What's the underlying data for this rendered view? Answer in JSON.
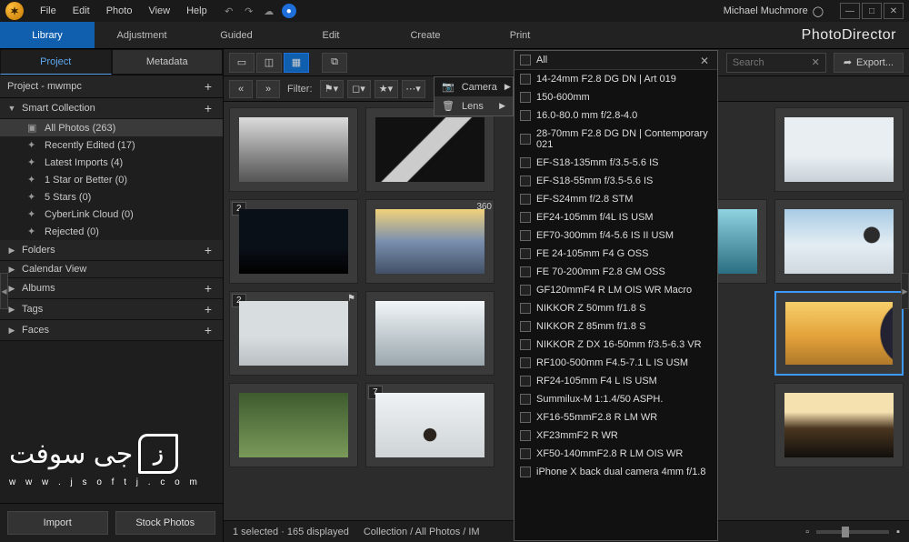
{
  "menu": {
    "file": "File",
    "edit": "Edit",
    "photo": "Photo",
    "view": "View",
    "help": "Help"
  },
  "user": {
    "name": "Michael Muchmore"
  },
  "brand": "PhotoDirector",
  "modules": {
    "library": "Library",
    "adjustment": "Adjustment",
    "guided": "Guided",
    "edit": "Edit",
    "create": "Create",
    "print": "Print"
  },
  "side_tabs": {
    "project": "Project",
    "metadata": "Metadata"
  },
  "project_header": "Project - mwmpc",
  "smart_collection": "Smart Collection",
  "tree_items": {
    "all_photos": "All Photos (263)",
    "recently_edited": "Recently Edited (17)",
    "latest_imports": "Latest Imports (4)",
    "one_star": "1 Star or Better (0)",
    "five_stars": "5 Stars (0)",
    "cloud": "CyberLink Cloud (0)",
    "rejected": "Rejected (0)"
  },
  "sections": {
    "folders": "Folders",
    "calendar": "Calendar View",
    "albums": "Albums",
    "tags": "Tags",
    "faces": "Faces"
  },
  "side_buttons": {
    "import": "Import",
    "stock": "Stock Photos"
  },
  "toolbar": {
    "filter_label": "Filter:",
    "search_placeholder": "Search",
    "export": "Export..."
  },
  "submenu": {
    "camera": "Camera",
    "lens": "Lens"
  },
  "lens_filter": {
    "all": "All",
    "items": [
      "14-24mm F2.8 DG DN | Art 019",
      "150-600mm",
      "16.0-80.0 mm f/2.8-4.0",
      "28-70mm F2.8 DG DN | Contemporary 021",
      "EF-S18-135mm f/3.5-5.6 IS",
      "EF-S18-55mm f/3.5-5.6 IS",
      "EF-S24mm f/2.8 STM",
      "EF24-105mm f/4L IS USM",
      "EF70-300mm f/4-5.6 IS II USM",
      "FE 24-105mm F4 G OSS",
      "FE 70-200mm F2.8 GM OSS",
      "GF120mmF4 R LM OIS WR Macro",
      "NIKKOR Z 50mm f/1.8 S",
      "NIKKOR Z 85mm f/1.8 S",
      "NIKKOR Z DX 16-50mm f/3.5-6.3 VR",
      "RF100-500mm F4.5-7.1 L IS USM",
      "RF24-105mm F4 L IS USM",
      "Summilux-M 1:1.4/50 ASPH.",
      "XF16-55mmF2.8 R LM WR",
      "XF23mmF2 R WR",
      "XF50-140mmF2.8 R LM OIS WR",
      "iPhone X back dual camera 4mm f/1.8"
    ]
  },
  "thumb_badges": {
    "two": "2",
    "seven": "7",
    "threesixty": "360"
  },
  "status": {
    "selected": "1 selected · 165 displayed",
    "path": "Collection / All Photos / IM"
  },
  "watermark": {
    "text": "جى سوفت",
    "url": "w w w . j s o f t j . c o m"
  }
}
